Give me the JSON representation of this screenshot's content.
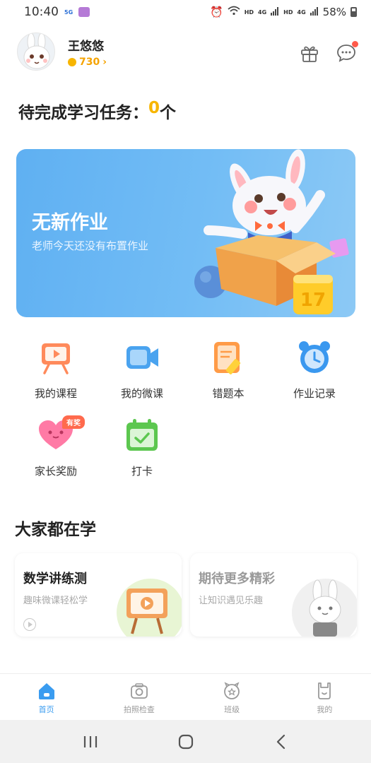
{
  "status_bar": {
    "time": "10:40",
    "left_tags": [
      "5G"
    ],
    "right_tags": [
      "HD",
      "4G",
      "HD",
      "4G"
    ],
    "battery": "58%"
  },
  "profile": {
    "name": "王悠悠",
    "coins": "730"
  },
  "pending": {
    "label": "待完成学习任务：",
    "count": "0",
    "unit": "个"
  },
  "banner": {
    "title": "无新作业",
    "subtitle": "老师今天还没有布置作业",
    "block_number": "17"
  },
  "grid": {
    "items": [
      {
        "label": "我的课程"
      },
      {
        "label": "我的微课"
      },
      {
        "label": "错题本"
      },
      {
        "label": "作业记录"
      },
      {
        "label": "家长奖励",
        "badge": "有奖"
      },
      {
        "label": "打卡"
      }
    ]
  },
  "section": {
    "title": "大家都在学",
    "cards": [
      {
        "title": "数学讲练测",
        "subtitle": "趣味微课轻松学"
      },
      {
        "title": "期待更多精彩",
        "subtitle": "让知识遇见乐趣"
      }
    ]
  },
  "bottom_nav": {
    "items": [
      {
        "label": "首页",
        "icon": "home-icon"
      },
      {
        "label": "拍照检查",
        "icon": "camera-icon"
      },
      {
        "label": "班级",
        "icon": "class-icon"
      },
      {
        "label": "我的",
        "icon": "profile-icon"
      }
    ]
  },
  "colors": {
    "accent": "#3a9cf0",
    "coin": "#f7b500",
    "banner": "#6cb9f4"
  }
}
